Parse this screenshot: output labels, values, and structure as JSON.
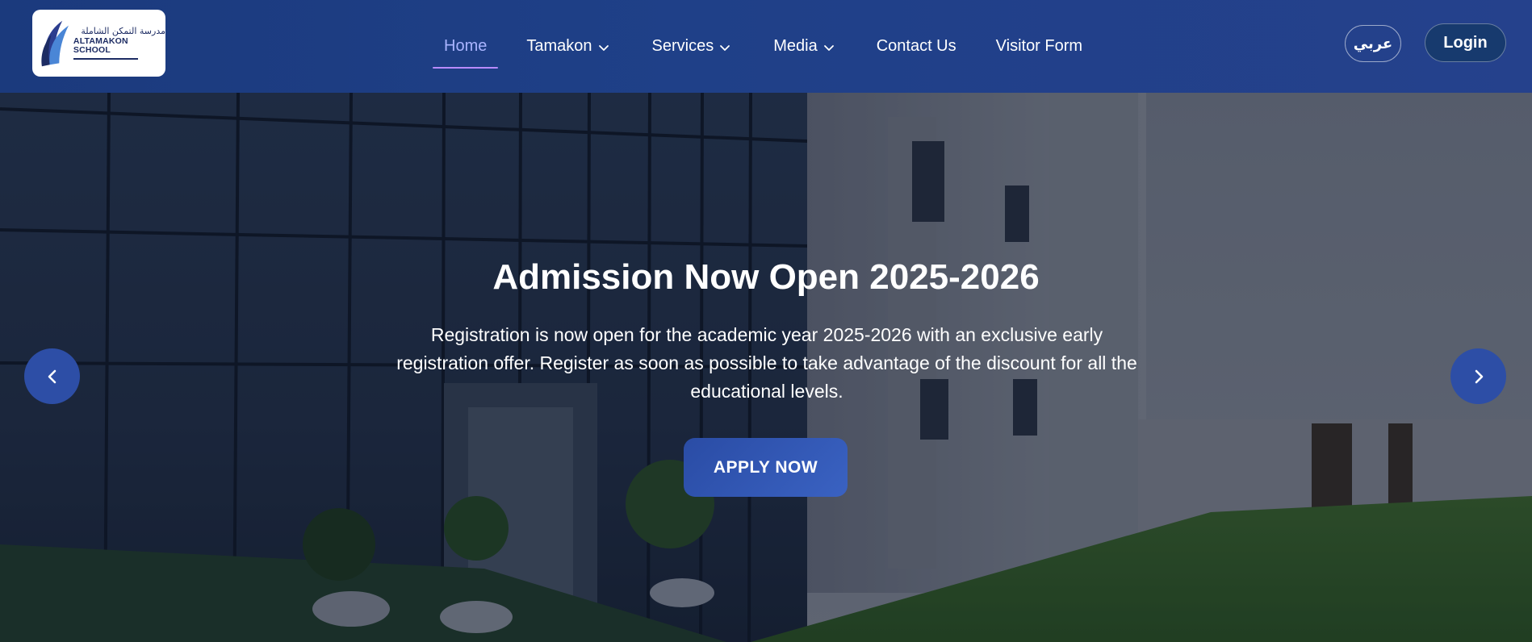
{
  "logo": {
    "arabic_name": "مدرسة التمكن الشاملة",
    "english_name": "ALTAMAKON SCHOOL"
  },
  "nav": {
    "items": [
      {
        "label": "Home",
        "active": true,
        "has_dropdown": false
      },
      {
        "label": "Tamakon",
        "active": false,
        "has_dropdown": true
      },
      {
        "label": "Services",
        "active": false,
        "has_dropdown": true
      },
      {
        "label": "Media",
        "active": false,
        "has_dropdown": true
      },
      {
        "label": "Contact Us",
        "active": false,
        "has_dropdown": false
      },
      {
        "label": "Visitor Form",
        "active": false,
        "has_dropdown": false
      }
    ],
    "language_label": "عربي",
    "login_label": "Login"
  },
  "hero": {
    "title": "Admission Now Open 2025-2026",
    "description": "Registration is now open for the academic year 2025-2026 with an exclusive early registration offer. Register as soon as possible to take advantage of the discount for all the educational levels.",
    "cta_label": "APPLY NOW",
    "prev_icon": "chevron-left-icon",
    "next_icon": "chevron-right-icon"
  },
  "colors": {
    "header_bg": "#1f4088",
    "active_nav": "#a9b4ff",
    "active_underline": "#b98bff",
    "cta_bg": "#2f54b3",
    "arrow_bg": "#2d4ea6"
  }
}
